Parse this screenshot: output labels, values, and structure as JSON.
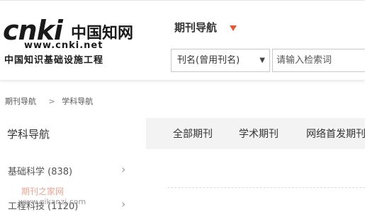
{
  "logo": {
    "wordmark": "cnki",
    "chinese_name": "中国知网",
    "url": "www.cnki.net",
    "tagline": "中国知识基础设施工程"
  },
  "header": {
    "title": "期刊导航",
    "select_value": "刊名(曾用刊名)",
    "search_placeholder": "请输入检索词"
  },
  "breadcrumb": {
    "items": [
      "期刊导航",
      "学科导航"
    ],
    "separator": ">"
  },
  "sidebar": {
    "title": "学科导航",
    "items": [
      {
        "label": "基础科学 (838)"
      },
      {
        "label": "工程科技 (1120)"
      }
    ]
  },
  "tabs": [
    "全部期刊",
    "学术期刊",
    "网络首发期刊"
  ],
  "watermark": {
    "line1": "期刊之家网",
    "line2": "www.qikanzj.com"
  },
  "colors": {
    "accent_arrow": "#e05a3a",
    "tab_bar_bg": "#f3f3f3"
  }
}
